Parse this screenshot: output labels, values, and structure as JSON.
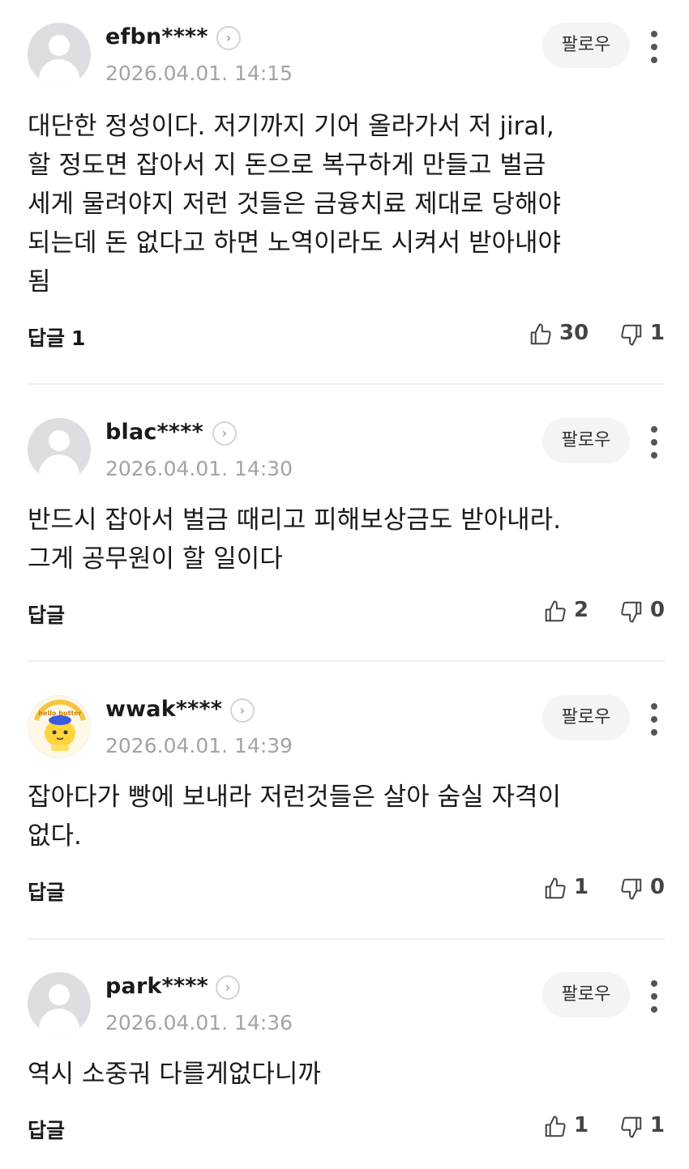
{
  "labels": {
    "follow": "팔로우",
    "reply": "답글"
  },
  "comments": [
    {
      "username": "efbn****",
      "date": "2026.04.01. 14:15",
      "avatar": "default-avatar",
      "text": "대단한 정성이다. 저기까지 기어 올라가서 저 jiral,\n할 정도면 잡아서 지 돈으로 복구하게 만들고 벌금\n세게 물려야지 저런 것들은 금융치료 제대로 당해야\n되는데 돈 없다고 하면 노역이라도 시켜서 받아내야\n됨",
      "reply_count": "1",
      "likes": "30",
      "dislikes": "1"
    },
    {
      "username": "blac****",
      "date": "2026.04.01. 14:30",
      "avatar": "default-avatar",
      "text": "반드시 잡아서 벌금 때리고 피해보상금도 받아내라.\n그게 공무원이 할 일이다",
      "reply_count": "",
      "likes": "2",
      "dislikes": "0"
    },
    {
      "username": "wwak****",
      "date": "2026.04.01. 14:39",
      "avatar": "hello-butter-character-avatar",
      "avatar_caption": "hello butter",
      "text": "잡아다가 빵에 보내라 저런것들은 살아 숨실 자격이\n없다.",
      "reply_count": "",
      "likes": "1",
      "dislikes": "0"
    },
    {
      "username": "park****",
      "date": "2026.04.01. 14:36",
      "avatar": "default-avatar",
      "text": "역시 소중궈 다를게없다니까",
      "reply_count": "",
      "likes": "1",
      "dislikes": "1"
    }
  ],
  "colors": {
    "text": "#1a1a1a",
    "muted": "#a3a3a3",
    "follow_bg": "#f4f4f4",
    "divider": "#efefef"
  }
}
